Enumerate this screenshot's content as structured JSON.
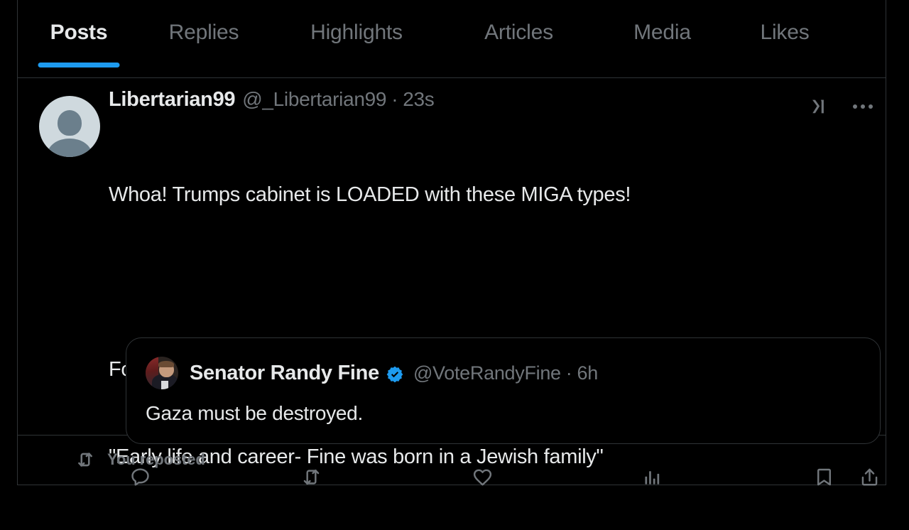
{
  "theme": {
    "background": "#000000",
    "text_primary": "#e7e9ea",
    "text_secondary": "#71767b",
    "accent": "#1d9bf0",
    "border": "#2f3336",
    "verified_badge": "#1d9bf0"
  },
  "tabs": [
    {
      "label": "Posts",
      "active": true
    },
    {
      "label": "Replies",
      "active": false
    },
    {
      "label": "Highlights",
      "active": false
    },
    {
      "label": "Articles",
      "active": false
    },
    {
      "label": "Media",
      "active": false
    },
    {
      "label": "Likes",
      "active": false
    }
  ],
  "post": {
    "avatar_icon": "default-avatar-icon",
    "display_name": "Libertarian99",
    "handle": "@_Libertarian99",
    "separator": "·",
    "timestamp": "23s",
    "body_line_1": "Whoa! Trumps cabinet is LOADED with these MIGA types!",
    "body_line_2": "Found the reason right here on WIKI BIO:",
    "body_line_3": "\"Early life and career- Fine was born in a Jewish family\"",
    "top_icons": {
      "grok": "grok-icon",
      "more": "more-options-icon"
    },
    "quote": {
      "avatar_icon": "profile-photo-avatar",
      "display_name": "Senator Randy Fine",
      "verified": true,
      "handle": "@VoteRandyFine",
      "separator": "·",
      "timestamp": "6h",
      "body": "Gaza must be destroyed."
    },
    "actions": [
      {
        "name": "reply",
        "icon": "reply-icon",
        "count": ""
      },
      {
        "name": "repost",
        "icon": "repost-icon",
        "count": ""
      },
      {
        "name": "like",
        "icon": "like-heart-icon",
        "count": ""
      },
      {
        "name": "views",
        "icon": "analytics-bar-icon",
        "count": ""
      },
      {
        "name": "bookmark",
        "icon": "bookmark-icon",
        "count": ""
      },
      {
        "name": "share",
        "icon": "share-upload-icon",
        "count": ""
      }
    ]
  },
  "footer": {
    "reposted_icon": "repost-icon",
    "reposted_label": "You reposted"
  }
}
